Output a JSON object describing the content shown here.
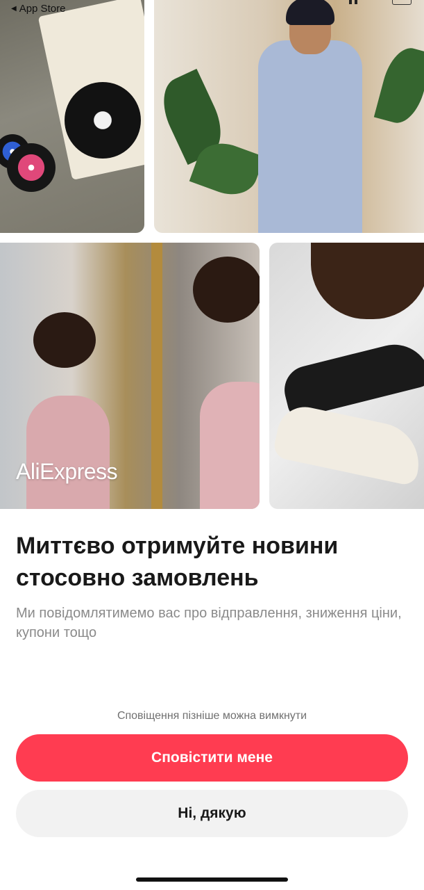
{
  "status_bar": {
    "back_label": "App Store",
    "back_icon": "back-triangle-icon"
  },
  "hero": {
    "brand_logo_text": "AliExpress"
  },
  "content": {
    "headline": "Миттєво отримуйте новини стосовно замовлень",
    "subtitle": "Ми повідомлятимемо вас про відправлення, зниження ціни, купони тощо"
  },
  "footer": {
    "hint": "Сповіщення пізніше можна вимкнути",
    "primary_button": "Сповістити мене",
    "secondary_button": "Ні, дякую"
  },
  "colors": {
    "accent": "#ff3c51",
    "secondary_button_bg": "#f2f2f2",
    "subtitle_text": "#8a8a8a"
  }
}
